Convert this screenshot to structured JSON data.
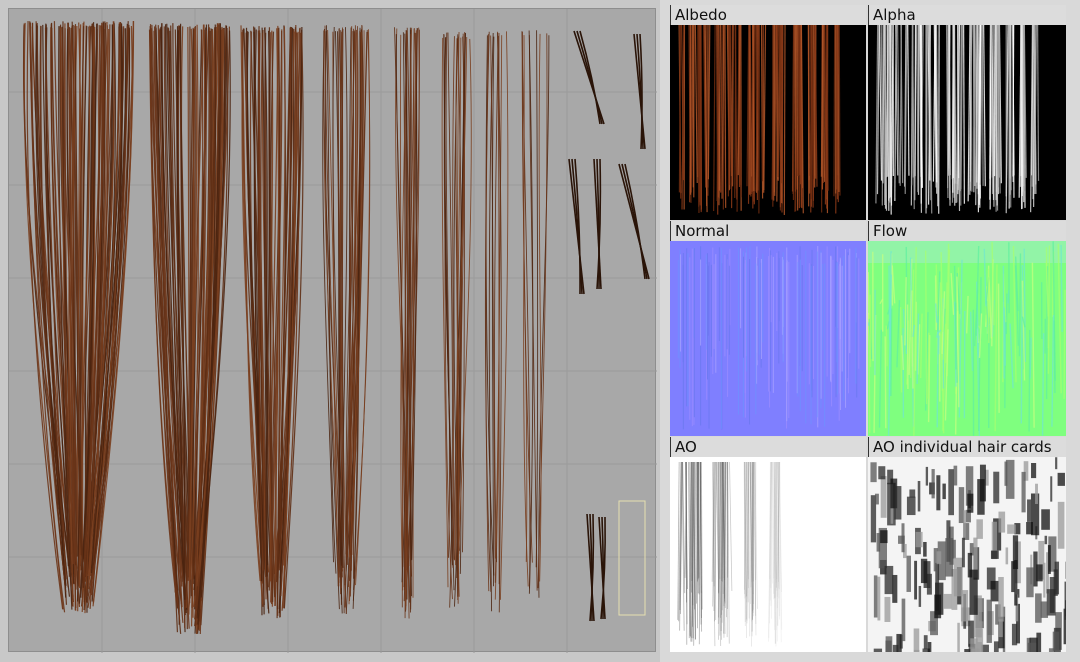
{
  "textures": [
    {
      "id": "albedo",
      "label": "Albedo"
    },
    {
      "id": "alpha",
      "label": "Alpha"
    },
    {
      "id": "normal",
      "label": "Normal"
    },
    {
      "id": "flow",
      "label": "Flow"
    },
    {
      "id": "ao",
      "label": "AO"
    },
    {
      "id": "ao-cards",
      "label": "AO individual hair cards"
    }
  ],
  "colors": {
    "hair_dark": "#4a2410",
    "hair_light": "#7a3f1f",
    "atlas_bg": "#a8a8a8",
    "albedo_bg": "#000000",
    "normal_base": "#7f7fff",
    "flow_base": "#7fff7f"
  }
}
